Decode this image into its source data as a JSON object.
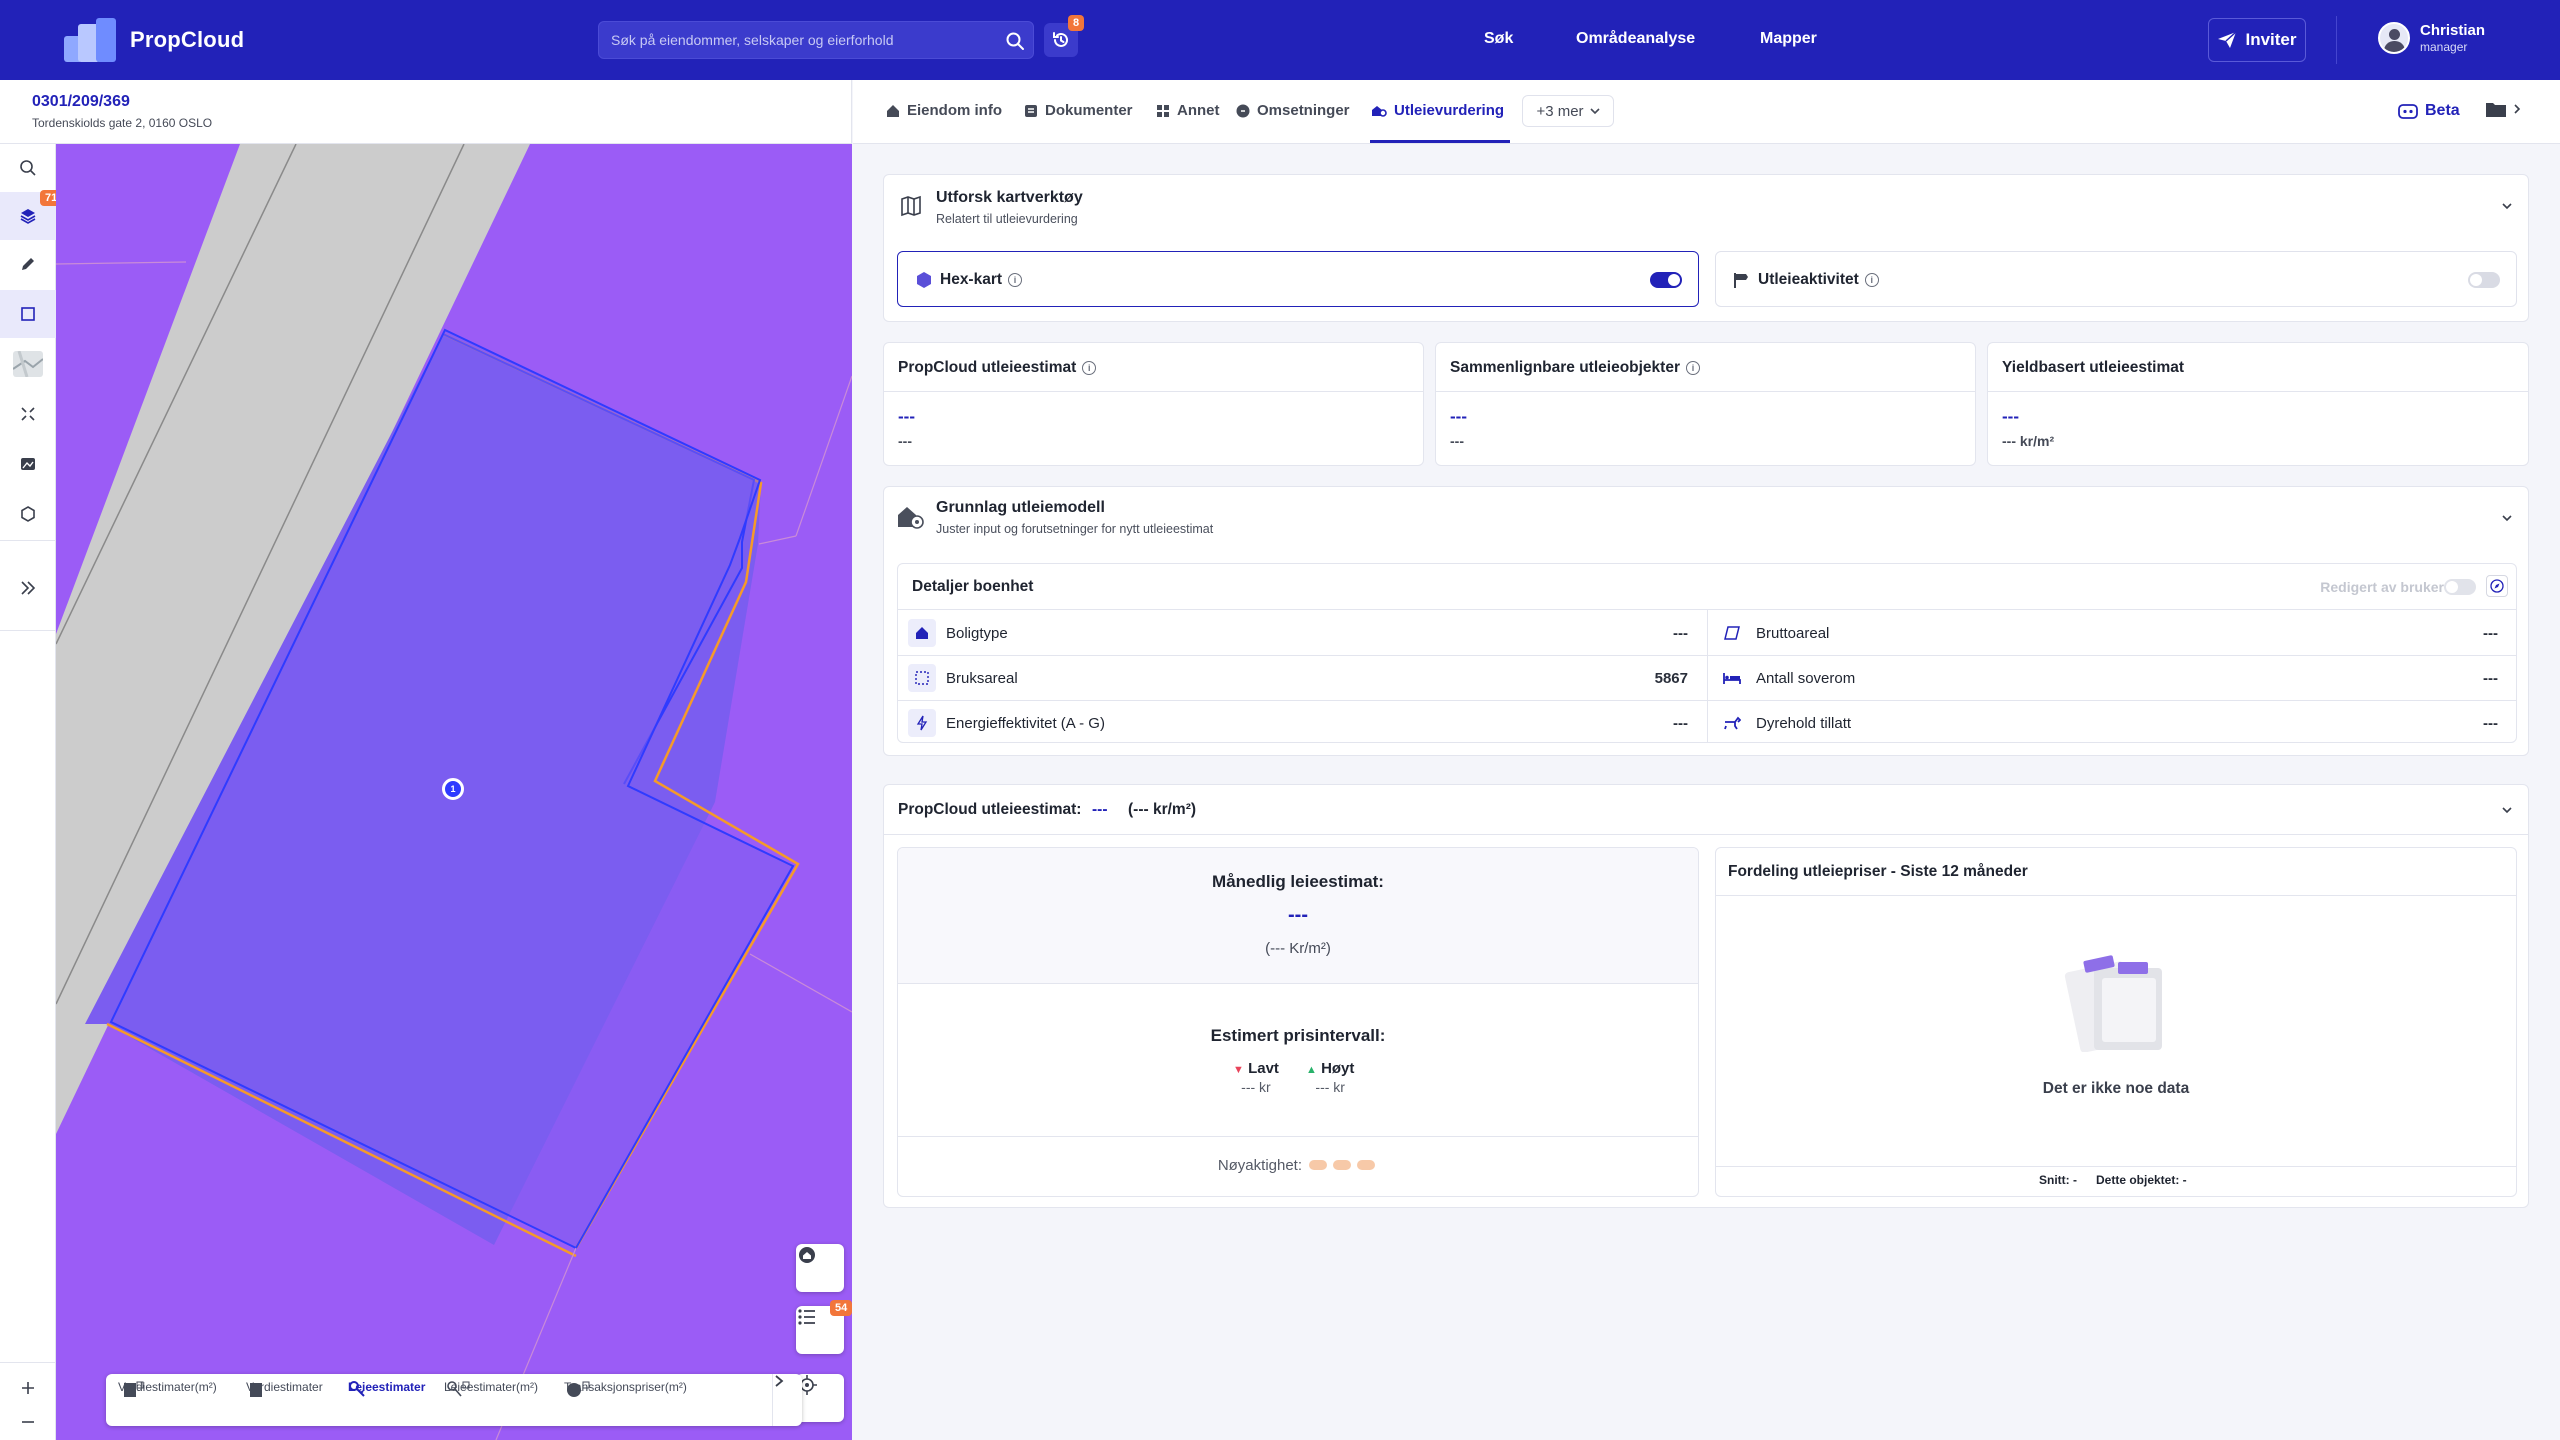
{
  "app": {
    "name": "PropCloud",
    "search_placeholder": "Søk på eiendommer, selskaper og eierforhold",
    "history_badge": "8",
    "nav": [
      "Søk",
      "Områdeanalyse",
      "Mapper"
    ],
    "invite_label": "Inviter",
    "user": {
      "name": "Christian",
      "role": "manager"
    }
  },
  "property": {
    "id": "0301/209/369",
    "address": "Tordenskiolds gate 2, 0160 OSLO"
  },
  "toolbar": {
    "layers_badge": "71"
  },
  "map": {
    "list_badge": "54",
    "marker_label": "1",
    "layers": [
      {
        "label": "Verdiestimater(m²)",
        "active": false
      },
      {
        "label": "Verdiestimater",
        "active": false
      },
      {
        "label": "Leieestimater",
        "active": true
      },
      {
        "label": "Leieestimater(m²)",
        "active": false
      },
      {
        "label": "Transaksjonspriser(m²)",
        "active": false
      }
    ]
  },
  "tabs": [
    {
      "label": "Eiendom info",
      "icon": "home-icon"
    },
    {
      "label": "Dokumenter",
      "icon": "document-icon"
    },
    {
      "label": "Annet",
      "icon": "building-icon"
    },
    {
      "label": "Omsetninger",
      "icon": "coin-icon"
    },
    {
      "label": "Utleievurdering",
      "icon": "rental-icon",
      "active": true
    }
  ],
  "more_tabs_label": "+3 mer",
  "beta_label": "Beta",
  "map_tools": {
    "title": "Utforsk kartverktøy",
    "subtitle": "Relatert til utleievurdering",
    "hex": {
      "label": "Hex-kart",
      "on": true
    },
    "rental_activity": {
      "label": "Utleieaktivitet",
      "on": false
    }
  },
  "estimates": [
    {
      "title": "PropCloud utleieestimat",
      "has_info": true,
      "value": "---",
      "sub": "---"
    },
    {
      "title": "Sammenlignbare utleieobjekter",
      "has_info": true,
      "value": "---",
      "sub": "---"
    },
    {
      "title": "Yieldbasert utleieestimat",
      "has_info": false,
      "value": "---",
      "sub": "--- kr/m²"
    }
  ],
  "model": {
    "title": "Grunnlag utleiemodell",
    "subtitle": "Juster input og forutsetninger for nytt utleieestimat",
    "details_title": "Detaljer boenhet",
    "edited_label": "Redigert av bruker",
    "left_rows": [
      {
        "label": "Boligtype",
        "value": "---",
        "icon": "home-icon"
      },
      {
        "label": "Bruksareal",
        "value": "5867",
        "icon": "area-icon"
      },
      {
        "label": "Energieffektivitet (A - G)",
        "value": "---",
        "icon": "energy-icon"
      }
    ],
    "right_rows": [
      {
        "label": "Bruttoareal",
        "value": "---",
        "icon": "gross-area-icon"
      },
      {
        "label": "Antall soverom",
        "value": "---",
        "icon": "bed-icon"
      },
      {
        "label": "Dyrehold tillatt",
        "value": "---",
        "icon": "pet-icon"
      }
    ]
  },
  "summary": {
    "label": "PropCloud utleieestimat:",
    "value": "---",
    "per_m2": "(--- kr/m²)",
    "monthly_title": "Månedlig leieestimat:",
    "monthly_value": "---",
    "monthly_per": "(--- Kr/m²)",
    "interval_title": "Estimert prisintervall:",
    "low_label": "Lavt",
    "low_value": "--- kr",
    "high_label": "Høyt",
    "high_value": "--- kr",
    "accuracy_label": "Nøyaktighet:",
    "distribution_title": "Fordeling utleiepriser - Siste 12 måneder",
    "no_data": "Det er ikke noe data",
    "avg_label": "Snitt: -",
    "this_object_label": "Dette objektet: -"
  }
}
